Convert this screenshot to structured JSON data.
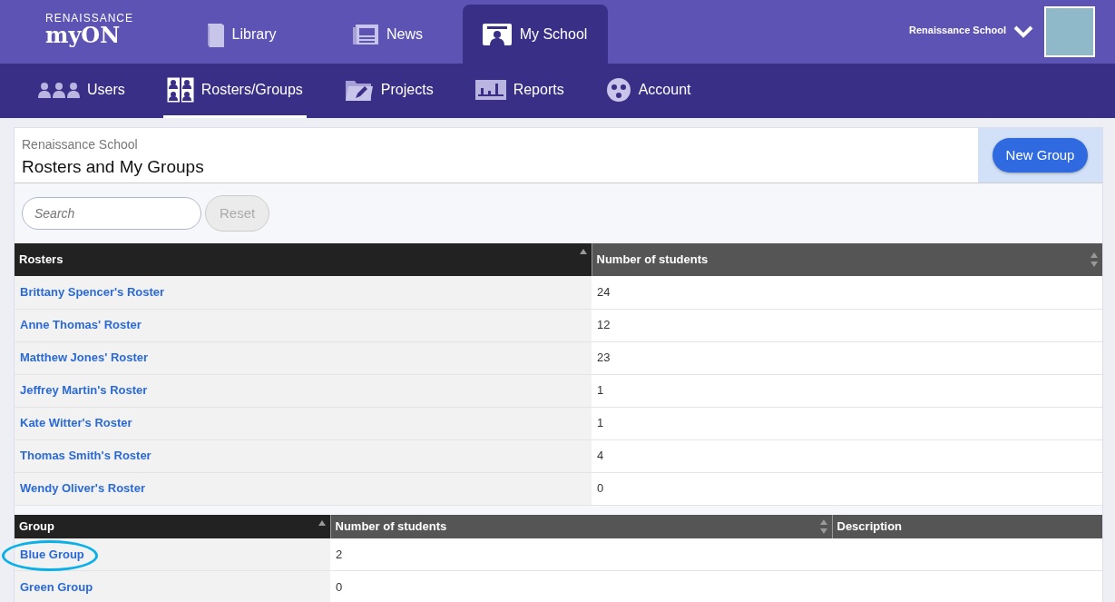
{
  "logo": {
    "top": "RENAISSANCE",
    "bottom": "myON"
  },
  "main_tabs": [
    {
      "label": "Library",
      "selected": false
    },
    {
      "label": "News",
      "selected": false
    },
    {
      "label": "My School",
      "selected": true
    }
  ],
  "user": {
    "name": "Renaissance School"
  },
  "sub_nav": [
    {
      "label": "Users",
      "selected": false
    },
    {
      "label": "Rosters/Groups",
      "selected": true
    },
    {
      "label": "Projects",
      "selected": false
    },
    {
      "label": "Reports",
      "selected": false
    },
    {
      "label": "Account",
      "selected": false
    }
  ],
  "header": {
    "subtitle": "Renaissance School",
    "title": "Rosters and My Groups",
    "button": "New Group"
  },
  "search": {
    "placeholder": "Search",
    "reset": "Reset"
  },
  "rosters_table": {
    "columns": [
      {
        "label": "Rosters",
        "sorted": true,
        "sortable": true
      },
      {
        "label": "Number of students",
        "sorted": false,
        "sortable": true
      }
    ],
    "rows": [
      {
        "name": "Brittany Spencer's Roster",
        "count": "24"
      },
      {
        "name": "Anne Thomas' Roster",
        "count": "12"
      },
      {
        "name": "Matthew Jones' Roster",
        "count": "23"
      },
      {
        "name": "Jeffrey Martin's Roster",
        "count": "1"
      },
      {
        "name": "Kate Witter's Roster",
        "count": "1"
      },
      {
        "name": "Thomas Smith's Roster",
        "count": "4"
      },
      {
        "name": "Wendy Oliver's Roster",
        "count": "0"
      }
    ]
  },
  "groups_table": {
    "columns": [
      {
        "label": "Group",
        "sorted": true,
        "sortable": true
      },
      {
        "label": "Number of students",
        "sorted": false,
        "sortable": true
      },
      {
        "label": "Description",
        "sortable": false
      }
    ],
    "rows": [
      {
        "name": "Blue Group",
        "count": "2",
        "circled": true
      },
      {
        "name": "Green Group",
        "count": "0",
        "circled": false
      }
    ]
  }
}
